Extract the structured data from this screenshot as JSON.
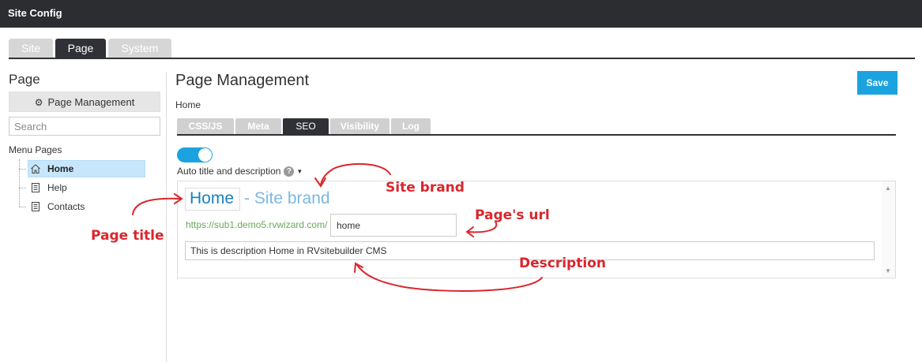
{
  "window": {
    "title": "Site Config"
  },
  "top_tabs": [
    {
      "label": "Site",
      "active": false
    },
    {
      "label": "Page",
      "active": true
    },
    {
      "label": "System",
      "active": false
    }
  ],
  "sidebar": {
    "title": "Page",
    "management_button": "Page Management",
    "search_placeholder": "Search",
    "menu_label": "Menu Pages",
    "items": [
      {
        "label": "Home",
        "icon": "home-icon",
        "selected": true
      },
      {
        "label": "Help",
        "icon": "page-icon",
        "selected": false
      },
      {
        "label": "Contacts",
        "icon": "page-icon",
        "selected": false
      }
    ]
  },
  "main": {
    "title": "Page Management",
    "save_label": "Save",
    "breadcrumb": "Home",
    "tabs": [
      {
        "label": "CSS/JS",
        "active": false
      },
      {
        "label": "Meta",
        "active": false
      },
      {
        "label": "SEO",
        "active": true
      },
      {
        "label": "Visibility",
        "active": false
      },
      {
        "label": "Log",
        "active": false
      }
    ],
    "auto_toggle_on": true,
    "auto_label": "Auto title and description",
    "seo": {
      "page_title": "Home",
      "brand_suffix": "- Site brand",
      "url_prefix": "https://sub1.demo5.rvwizard.com/",
      "url_value": "home",
      "description": "This is description Home in RVsitebuilder CMS"
    }
  },
  "annotations": {
    "site_brand": "Site brand",
    "page_url": "Page's url",
    "page_title": "Page title",
    "description": "Description"
  },
  "colors": {
    "accent": "#1ba3e0",
    "annotation": "#d9262c",
    "titlebar": "#2b2d31"
  }
}
